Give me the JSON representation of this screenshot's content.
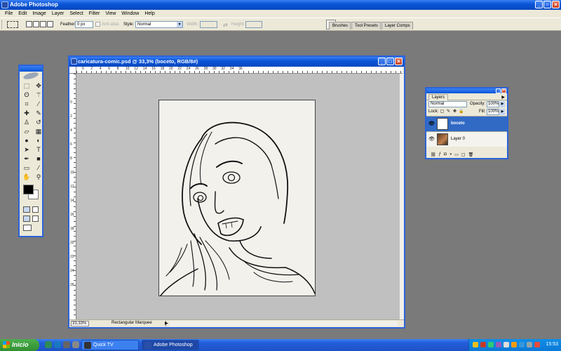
{
  "app": {
    "title": "Adobe Photoshop",
    "menu": [
      "File",
      "Edit",
      "Image",
      "Layer",
      "Select",
      "Filter",
      "View",
      "Window",
      "Help"
    ]
  },
  "options": {
    "feather_label": "Feather:",
    "feather_value": "0 px",
    "antialias_label": "Anti-alias",
    "style_label": "Style:",
    "style_value": "Normal",
    "width_label": "Width:",
    "height_label": "Height:"
  },
  "palette_well": {
    "tabs": [
      "Brushes",
      "Tool Presets",
      "Layer Comps"
    ]
  },
  "document": {
    "title": "caricatura-comic.psd @ 33,3% (boceto, RGB/8#)",
    "zoom": "33,33%",
    "status_info": "Rectangular Marquee",
    "ruler_h": [
      "0",
      "2",
      "4",
      "6",
      "8",
      "10",
      "12",
      "14",
      "16",
      "18",
      "20",
      "22",
      "24",
      "26",
      "28",
      "30",
      "32",
      "34",
      "36"
    ],
    "ruler_v": [
      "0",
      "2",
      "4",
      "6",
      "8",
      "10",
      "12",
      "14",
      "16",
      "18",
      "20",
      "22",
      "24",
      "26"
    ]
  },
  "layers": {
    "tab": "Layers",
    "blend_mode": "Normal",
    "opacity_label": "Opacity:",
    "opacity_value": "100%",
    "lock_label": "Lock:",
    "fill_label": "Fill:",
    "fill_value": "100%",
    "items": [
      {
        "name": "boceto",
        "active": true
      },
      {
        "name": "Layer 0",
        "active": false
      }
    ]
  },
  "taskbar": {
    "start_label": "Inicio",
    "tasks": [
      {
        "label": "Quick TV",
        "active": false
      },
      {
        "label": "Adobe Photoshop",
        "active": true
      }
    ],
    "clock": "15:53"
  },
  "colors": {
    "xp_blue": "#0a55d8",
    "selection_blue": "#316ac5",
    "workspace_gray": "#7a7a7a",
    "canvas_bg": "#c0c0c0",
    "artboard": "#f2f1ec"
  }
}
